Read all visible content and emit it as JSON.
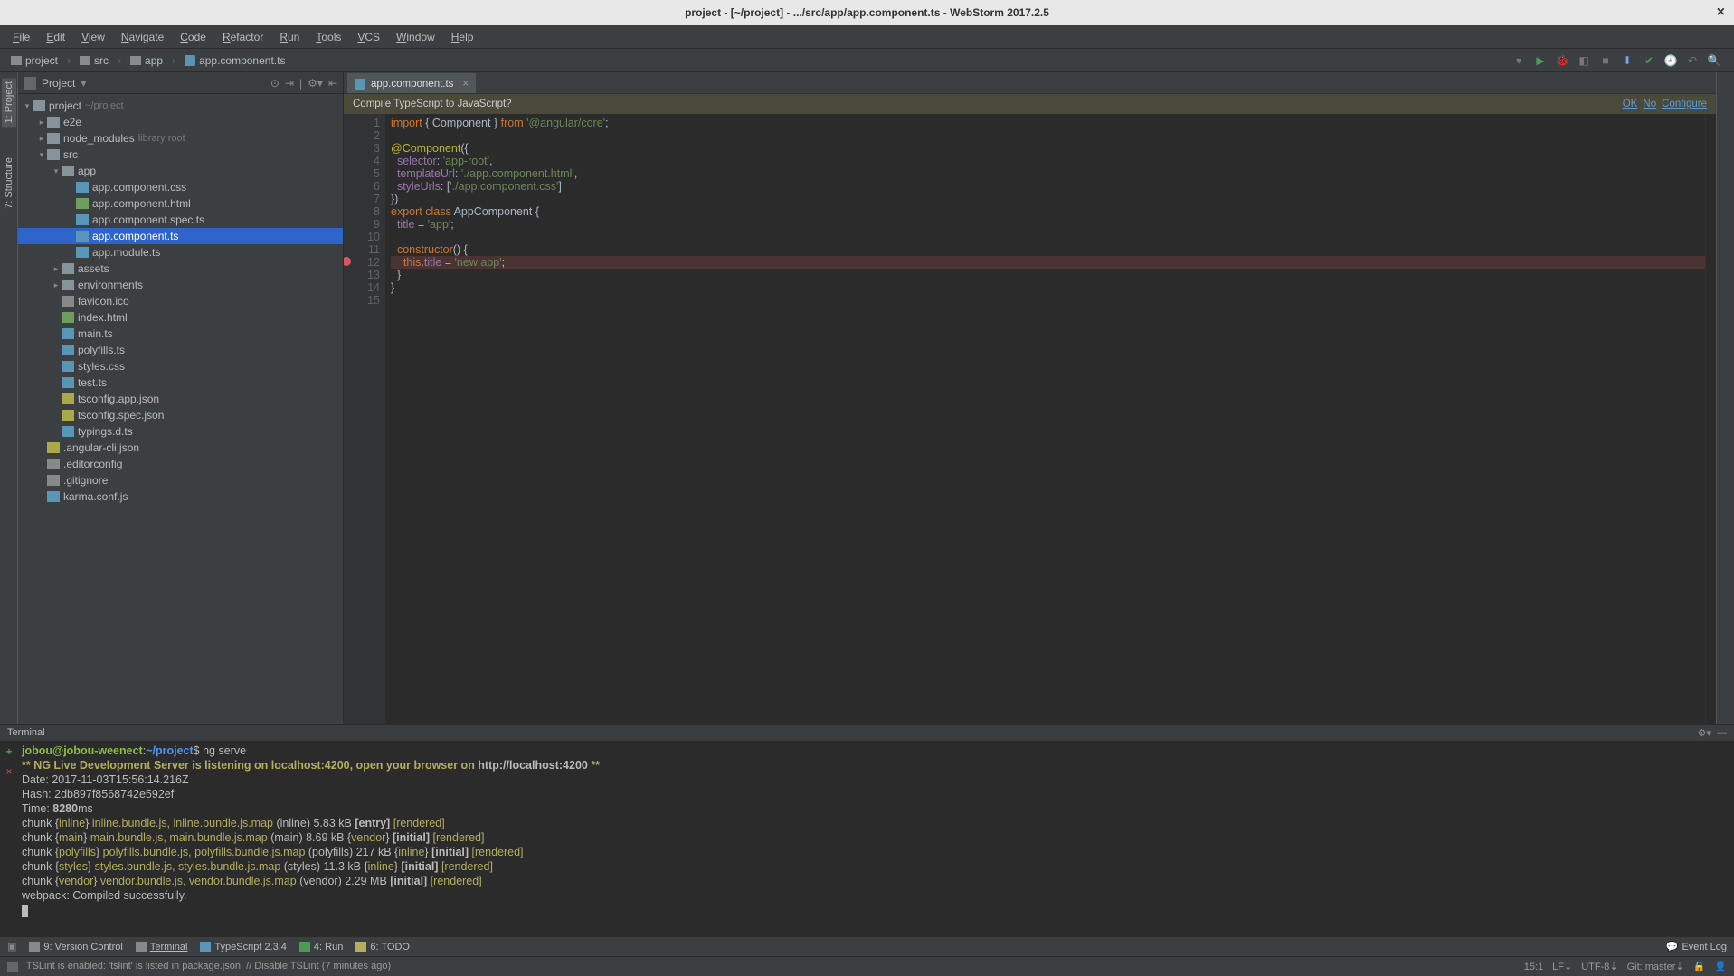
{
  "title": "project - [~/project] - .../src/app/app.component.ts - WebStorm 2017.2.5",
  "menubar": [
    "File",
    "Edit",
    "View",
    "Navigate",
    "Code",
    "Refactor",
    "Run",
    "Tools",
    "VCS",
    "Window",
    "Help"
  ],
  "breadcrumbs": [
    {
      "icon": "dir",
      "label": "project"
    },
    {
      "icon": "dir",
      "label": "src"
    },
    {
      "icon": "dir",
      "label": "app"
    },
    {
      "icon": "ts",
      "label": "app.component.ts"
    }
  ],
  "leftTabs": [
    "1: Project",
    "7: Structure"
  ],
  "projectHeader": {
    "title": "Project"
  },
  "tree": [
    {
      "depth": 0,
      "arrow": "open",
      "icon": "dir",
      "label": "project",
      "hint": "~/project"
    },
    {
      "depth": 1,
      "arrow": "closed",
      "icon": "dir",
      "label": "e2e"
    },
    {
      "depth": 1,
      "arrow": "closed",
      "icon": "dir",
      "label": "node_modules",
      "hint": "library root"
    },
    {
      "depth": 1,
      "arrow": "open",
      "icon": "dir",
      "label": "src"
    },
    {
      "depth": 2,
      "arrow": "open",
      "icon": "dir",
      "label": "app"
    },
    {
      "depth": 3,
      "arrow": "none",
      "icon": "css",
      "label": "app.component.css"
    },
    {
      "depth": 3,
      "arrow": "none",
      "icon": "html",
      "label": "app.component.html"
    },
    {
      "depth": 3,
      "arrow": "none",
      "icon": "ts",
      "label": "app.component.spec.ts"
    },
    {
      "depth": 3,
      "arrow": "none",
      "icon": "ts",
      "label": "app.component.ts",
      "selected": true
    },
    {
      "depth": 3,
      "arrow": "none",
      "icon": "ts",
      "label": "app.module.ts"
    },
    {
      "depth": 2,
      "arrow": "closed",
      "icon": "dir",
      "label": "assets"
    },
    {
      "depth": 2,
      "arrow": "closed",
      "icon": "dir",
      "label": "environments"
    },
    {
      "depth": 2,
      "arrow": "none",
      "icon": "txt",
      "label": "favicon.ico"
    },
    {
      "depth": 2,
      "arrow": "none",
      "icon": "html",
      "label": "index.html"
    },
    {
      "depth": 2,
      "arrow": "none",
      "icon": "ts",
      "label": "main.ts"
    },
    {
      "depth": 2,
      "arrow": "none",
      "icon": "ts",
      "label": "polyfills.ts"
    },
    {
      "depth": 2,
      "arrow": "none",
      "icon": "css",
      "label": "styles.css"
    },
    {
      "depth": 2,
      "arrow": "none",
      "icon": "ts",
      "label": "test.ts"
    },
    {
      "depth": 2,
      "arrow": "none",
      "icon": "json",
      "label": "tsconfig.app.json"
    },
    {
      "depth": 2,
      "arrow": "none",
      "icon": "json",
      "label": "tsconfig.spec.json"
    },
    {
      "depth": 2,
      "arrow": "none",
      "icon": "ts",
      "label": "typings.d.ts"
    },
    {
      "depth": 1,
      "arrow": "none",
      "icon": "json",
      "label": ".angular-cli.json"
    },
    {
      "depth": 1,
      "arrow": "none",
      "icon": "txt",
      "label": ".editorconfig"
    },
    {
      "depth": 1,
      "arrow": "none",
      "icon": "txt",
      "label": ".gitignore"
    },
    {
      "depth": 1,
      "arrow": "none",
      "icon": "ts",
      "label": "karma.conf.js"
    }
  ],
  "editorTab": {
    "label": "app.component.ts"
  },
  "tsBanner": {
    "msg": "Compile TypeScript to JavaScript?",
    "ok": "OK",
    "no": "No",
    "conf": "Configure"
  },
  "code": {
    "lines": 15,
    "breakpointLine": 12,
    "tokens": [
      [
        [
          "kw",
          "import "
        ],
        [
          "punc",
          "{ "
        ],
        [
          "type",
          "Component"
        ],
        [
          "punc",
          " } "
        ],
        [
          "kw",
          "from "
        ],
        [
          "str",
          "'@angular/core'"
        ],
        [
          "punc",
          ";"
        ]
      ],
      [],
      [
        [
          "dec",
          "@Component"
        ],
        [
          "punc",
          "({"
        ]
      ],
      [
        [
          "punc",
          "  "
        ],
        [
          "prop",
          "selector"
        ],
        [
          "punc",
          ": "
        ],
        [
          "str",
          "'app-root'"
        ],
        [
          "punc",
          ","
        ]
      ],
      [
        [
          "punc",
          "  "
        ],
        [
          "prop",
          "templateUrl"
        ],
        [
          "punc",
          ": "
        ],
        [
          "str",
          "'./app.component.html'"
        ],
        [
          "punc",
          ","
        ]
      ],
      [
        [
          "punc",
          "  "
        ],
        [
          "prop",
          "styleUrls"
        ],
        [
          "punc",
          ": ["
        ],
        [
          "str",
          "'./app.component.css'"
        ],
        [
          "punc",
          "]"
        ]
      ],
      [
        [
          "punc",
          "})"
        ]
      ],
      [
        [
          "kw",
          "export class "
        ],
        [
          "type",
          "AppComponent "
        ],
        [
          "punc",
          "{"
        ]
      ],
      [
        [
          "punc",
          "  "
        ],
        [
          "prop",
          "title"
        ],
        [
          "punc",
          " = "
        ],
        [
          "str",
          "'app'"
        ],
        [
          "punc",
          ";"
        ]
      ],
      [],
      [
        [
          "punc",
          "  "
        ],
        [
          "kw",
          "constructor"
        ],
        [
          "punc",
          "() {"
        ]
      ],
      [
        [
          "punc",
          "    "
        ],
        [
          "kw",
          "this"
        ],
        [
          "punc",
          "."
        ],
        [
          "prop",
          "title"
        ],
        [
          "punc",
          " = "
        ],
        [
          "str",
          "'new app'"
        ],
        [
          "punc",
          ";"
        ]
      ],
      [
        [
          "punc",
          "  }"
        ]
      ],
      [
        [
          "punc",
          "}"
        ]
      ],
      []
    ]
  },
  "terminalHeader": "Terminal",
  "terminal": {
    "prompt_user": "jobou@jobou-weenect",
    "prompt_sep": ":",
    "prompt_path": "~/project",
    "prompt_end": "$",
    "cmd": " ng serve",
    "lines": [
      {
        "segs": [
          [
            "yb",
            "** NG Live Development Server is listening on localhost:4200, open your browser on "
          ],
          [
            "bold",
            "http://localhost:4200"
          ],
          [
            "yb",
            " **"
          ]
        ]
      },
      {
        "segs": [
          [
            "",
            "Date: 2017-11-03T15:56:14.216Z"
          ]
        ]
      },
      {
        "segs": [
          [
            "",
            "Hash: 2db897f8568742e592ef"
          ]
        ]
      },
      {
        "segs": [
          [
            "",
            "Time: "
          ],
          [
            "bold",
            "8280"
          ],
          [
            "",
            "ms"
          ]
        ]
      },
      {
        "segs": [
          [
            "",
            "chunk {"
          ],
          [
            "y",
            "inline"
          ],
          [
            "",
            "} "
          ],
          [
            "y",
            "inline.bundle.js, inline.bundle.js.map"
          ],
          [
            "",
            " (inline) 5.83 kB "
          ],
          [
            "bold",
            "[entry]"
          ],
          [
            "",
            " "
          ],
          [
            "y",
            "[rendered]"
          ]
        ]
      },
      {
        "segs": [
          [
            "",
            "chunk {"
          ],
          [
            "y",
            "main"
          ],
          [
            "",
            "} "
          ],
          [
            "y",
            "main.bundle.js, main.bundle.js.map"
          ],
          [
            "",
            " (main) 8.69 kB {"
          ],
          [
            "y",
            "vendor"
          ],
          [
            "",
            "} "
          ],
          [
            "bold",
            "[initial]"
          ],
          [
            "",
            " "
          ],
          [
            "y",
            "[rendered]"
          ]
        ]
      },
      {
        "segs": [
          [
            "",
            "chunk {"
          ],
          [
            "y",
            "polyfills"
          ],
          [
            "",
            "} "
          ],
          [
            "y",
            "polyfills.bundle.js, polyfills.bundle.js.map"
          ],
          [
            "",
            " (polyfills) 217 kB {"
          ],
          [
            "y",
            "inline"
          ],
          [
            "",
            "} "
          ],
          [
            "bold",
            "[initial]"
          ],
          [
            "",
            " "
          ],
          [
            "y",
            "[rendered]"
          ]
        ]
      },
      {
        "segs": [
          [
            "",
            "chunk {"
          ],
          [
            "y",
            "styles"
          ],
          [
            "",
            "} "
          ],
          [
            "y",
            "styles.bundle.js, styles.bundle.js.map"
          ],
          [
            "",
            " (styles) 11.3 kB {"
          ],
          [
            "y",
            "inline"
          ],
          [
            "",
            "} "
          ],
          [
            "bold",
            "[initial]"
          ],
          [
            "",
            " "
          ],
          [
            "y",
            "[rendered]"
          ]
        ]
      },
      {
        "segs": [
          [
            "",
            "chunk {"
          ],
          [
            "y",
            "vendor"
          ],
          [
            "",
            "} "
          ],
          [
            "y",
            "vendor.bundle.js, vendor.bundle.js.map"
          ],
          [
            "",
            " (vendor) 2.29 MB "
          ],
          [
            "bold",
            "[initial]"
          ],
          [
            "",
            " "
          ],
          [
            "y",
            "[rendered]"
          ]
        ]
      },
      {
        "segs": [
          [
            "",
            ""
          ]
        ]
      },
      {
        "segs": [
          [
            "",
            "webpack: Compiled successfully."
          ]
        ]
      }
    ]
  },
  "bottombar": {
    "items": [
      {
        "icon": "vc",
        "label": "9: Version Control"
      },
      {
        "icon": "term",
        "label": "Terminal",
        "active": true
      },
      {
        "icon": "ts",
        "label": "TypeScript 2.3.4"
      },
      {
        "icon": "run",
        "label": "4: Run"
      },
      {
        "icon": "todo",
        "label": "6: TODO"
      }
    ],
    "eventLog": "Event Log"
  },
  "status": {
    "msg": "TSLint is enabled: 'tslint' is listed in package.json. // Disable TSLint (7 minutes ago)",
    "pos": "15:1",
    "lf": "LF",
    "enc": "UTF-8",
    "git": "Git: master"
  }
}
